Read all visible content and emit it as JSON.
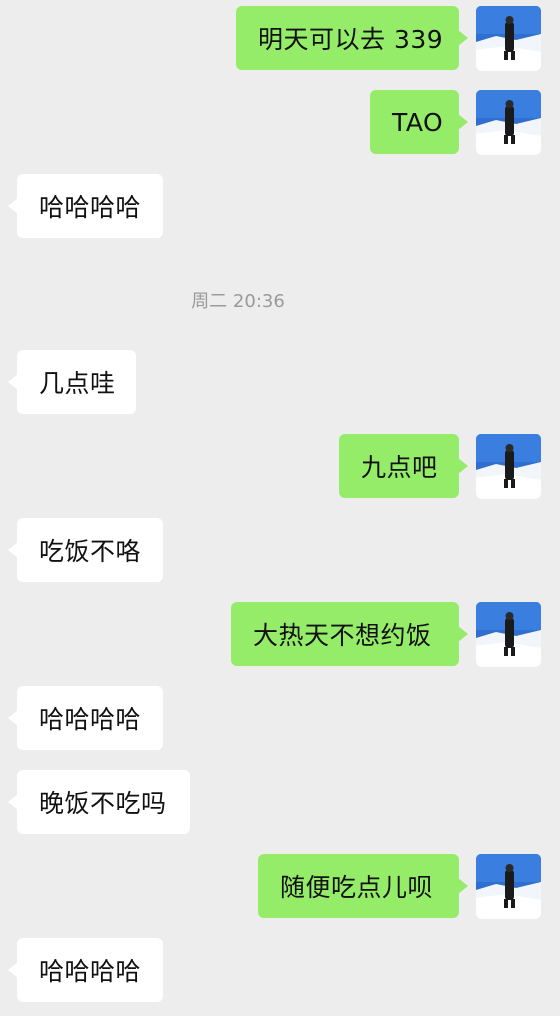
{
  "messages": [
    {
      "side": "sent",
      "text": "明天可以去 339"
    },
    {
      "side": "sent",
      "text": "TAO"
    },
    {
      "side": "received",
      "text": "哈哈哈哈"
    },
    {
      "side": "received",
      "text": "几点哇"
    },
    {
      "side": "sent",
      "text": "九点吧"
    },
    {
      "side": "received",
      "text": "吃饭不咯"
    },
    {
      "side": "sent",
      "text": "大热天不想约饭"
    },
    {
      "side": "received",
      "text": "哈哈哈哈"
    },
    {
      "side": "received",
      "text": "晚饭不吃吗"
    },
    {
      "side": "sent",
      "text": "随便吃点儿呗"
    },
    {
      "side": "received",
      "text": "哈哈哈哈"
    }
  ],
  "timestamp": "周二 20:36",
  "colors": {
    "background": "#ededed",
    "sent_bubble": "#95ec69",
    "received_bubble": "#ffffff",
    "timestamp_text": "#9a9a9a"
  },
  "icons": {
    "avatar": "user-avatar-snow-photo"
  }
}
